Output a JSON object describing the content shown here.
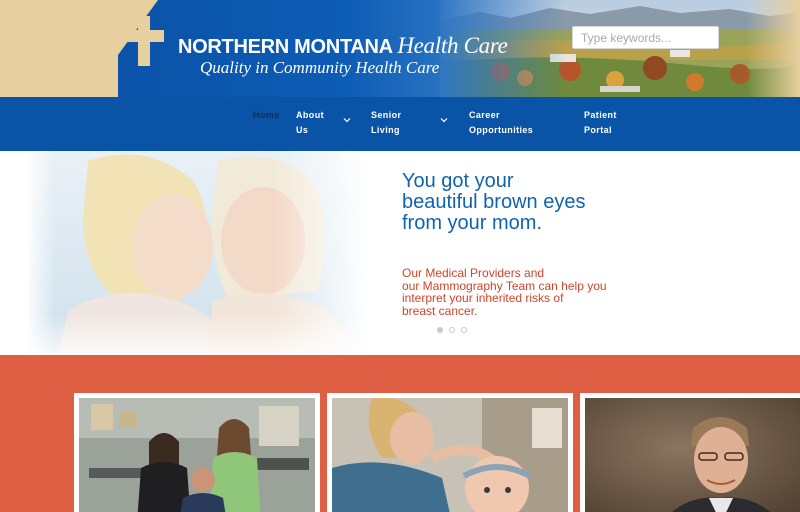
{
  "header": {
    "logo_title": "NORTHERN MONTANA",
    "logo_title_suffix": "Health Care",
    "tagline": "Quality in Community Health Care",
    "search_placeholder": "Type keywords..."
  },
  "nav": {
    "items": [
      {
        "lines": [
          "Home"
        ],
        "active": true,
        "has_submenu": false
      },
      {
        "lines": [
          "About",
          "Us"
        ],
        "active": false,
        "has_submenu": true
      },
      {
        "lines": [
          "Senior",
          "Living"
        ],
        "active": false,
        "has_submenu": true
      },
      {
        "lines": [
          "Career",
          "Opportunities"
        ],
        "active": false,
        "has_submenu": false
      },
      {
        "lines": [
          "Patient",
          "Portal"
        ],
        "active": false,
        "has_submenu": false
      }
    ]
  },
  "hero": {
    "headline_lines": [
      "You got your",
      "beautiful brown eyes",
      "from your mom."
    ],
    "subtext_lines": [
      "Our Medical Providers and",
      "our Mammography Team can help you",
      "interpret your inherited risks of",
      "breast cancer."
    ],
    "slide_count": 3,
    "active_slide": 1
  },
  "colors": {
    "nav_blue": "#0a54a8",
    "headline_blue": "#0f63b4",
    "accent_red": "#d2432a",
    "band_orange": "#df5f44",
    "header_tan": "#e7cf9f"
  }
}
